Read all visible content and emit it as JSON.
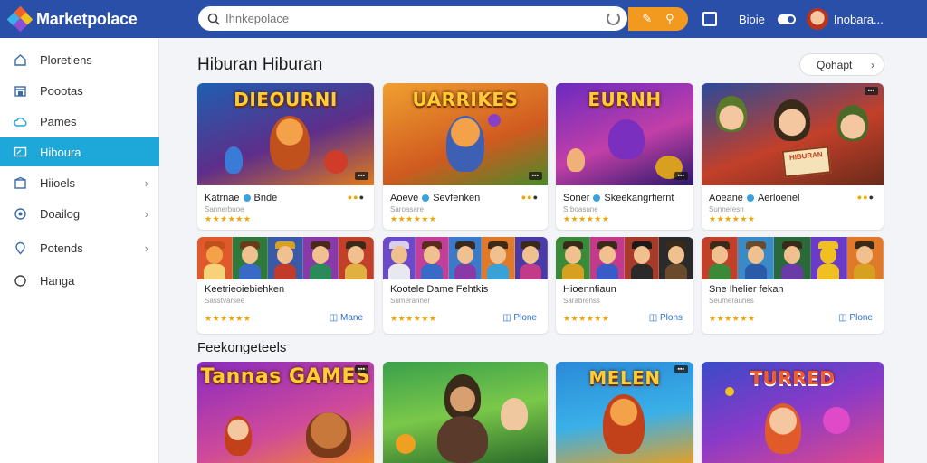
{
  "topbar": {
    "brand": "Marketpolace",
    "search_placeholder": "Ihnkepolace",
    "label": "Bioie",
    "user": "Inobara..."
  },
  "sidebar": {
    "items": [
      {
        "label": "Ploretiens",
        "icon": "home-icon",
        "chevron": false,
        "active": false
      },
      {
        "label": "Poootas",
        "icon": "store-icon",
        "chevron": false,
        "active": false
      },
      {
        "label": "Pames",
        "icon": "cloud-icon",
        "chevron": false,
        "active": false
      },
      {
        "label": "Hiboura",
        "icon": "screen-icon",
        "chevron": false,
        "active": true
      },
      {
        "label": "Hiioels",
        "icon": "house-icon",
        "chevron": true,
        "active": false
      },
      {
        "label": "Doailog",
        "icon": "globe-icon",
        "chevron": true,
        "active": false
      },
      {
        "label": "Potends",
        "icon": "location-icon",
        "chevron": true,
        "active": false
      },
      {
        "label": "Hanga",
        "icon": "circle-icon",
        "chevron": false,
        "active": false
      }
    ]
  },
  "main": {
    "section1_title": "Hiburan Hiburan",
    "sort_label": "Qohapt",
    "section2_title": "Feekongeteels",
    "featured": [
      {
        "thumb_title": "DIEOURNI",
        "tag": "▪▪▪",
        "name_a": "Katrnae",
        "name_b": "Bnde",
        "sub": "Sannerbuoe"
      },
      {
        "thumb_title": "UARRIKES",
        "tag": "▪▪▪",
        "name_a": "Aoeve",
        "name_b": "Sevfenken",
        "sub": "Saroasare"
      },
      {
        "thumb_title": "EURNH",
        "tag": "▪▪▪",
        "name_a": "Soner",
        "name_b": "Skeekangrfiernt",
        "sub": "Srboasune"
      },
      {
        "thumb_title": "HIBURAN",
        "tag": "▪▪▪",
        "name_a": "Aoeane",
        "name_b": "Aerloenel",
        "sub": "Sunneresn"
      }
    ],
    "bundles": [
      {
        "name": "Keetrieoiebiehken",
        "sub": "Sasstvarsee",
        "free": "Mane"
      },
      {
        "name": "Kootele Dame Fehtkis",
        "sub": "Sumeranner",
        "free": "Plone"
      },
      {
        "name": "Hioennfiaun",
        "sub": "Sarabrenss",
        "free": "Plons"
      },
      {
        "name": "Sne Ihelier fekan",
        "sub": "Seumeraunes",
        "free": "Plone"
      }
    ],
    "more": [
      {
        "thumb_title": "Tannas GAMES",
        "tag": "▪▪▪"
      },
      {
        "thumb_title": "",
        "tag": ""
      },
      {
        "thumb_title": "MELEN",
        "tag": "▪▪▪"
      },
      {
        "thumb_title": "TURRED",
        "tag": ""
      }
    ],
    "stars": "★★★★★★",
    "dots": "●●●"
  }
}
